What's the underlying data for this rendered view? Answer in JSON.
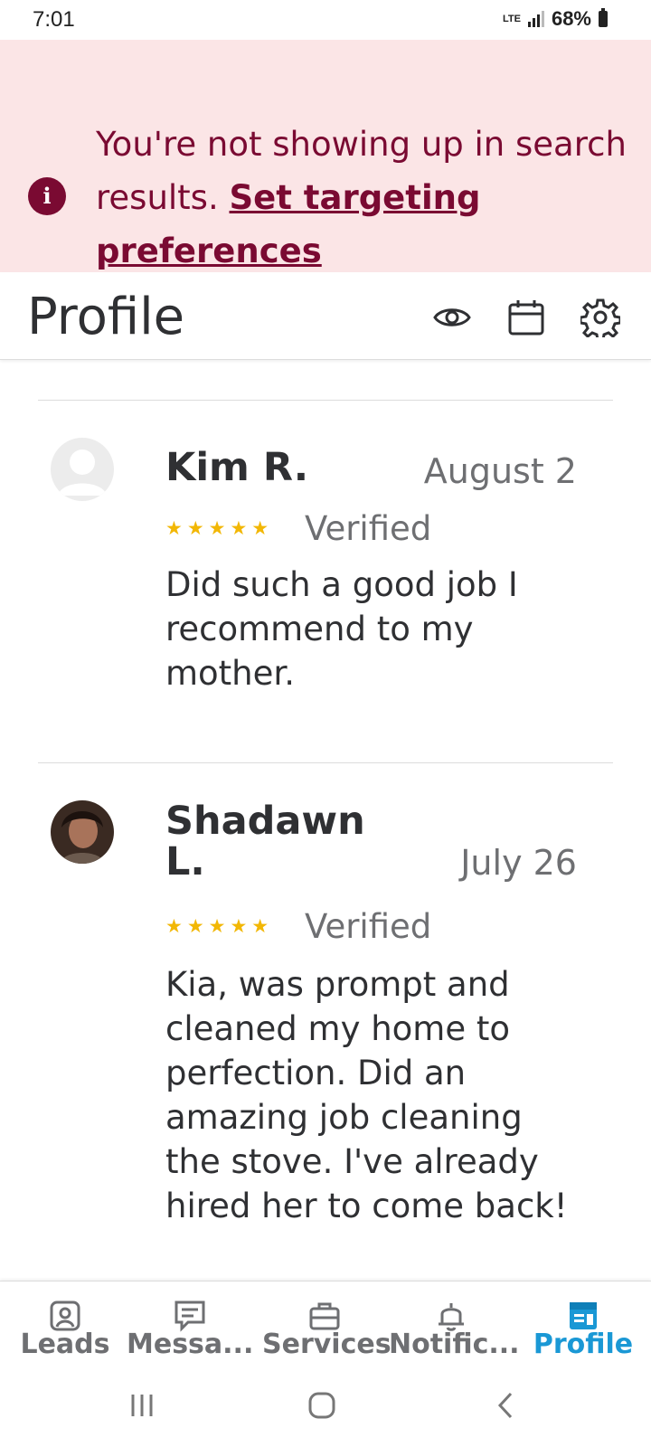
{
  "status_bar": {
    "time": "7:01",
    "network": "LTE",
    "battery": "68%"
  },
  "banner": {
    "text": "You're not showing up in search results.",
    "link": "Set targeting preferences"
  },
  "header": {
    "title": "Profile"
  },
  "reviews": [
    {
      "name": "Kim R.",
      "date": "August 2",
      "stars": "★★★★★",
      "verified": "Verified",
      "text": "Did such a good job I recommend to my mother."
    },
    {
      "name": "Shadawn L.",
      "date": "July 26",
      "stars": "★★★★★",
      "verified": "Verified",
      "text": "Kia, was prompt and cleaned my home to perfection. Did an amazing job cleaning the stove. I've already hired her to come back!"
    }
  ],
  "nav": {
    "items": [
      {
        "label": "Leads"
      },
      {
        "label": "Messa..."
      },
      {
        "label": "Services"
      },
      {
        "label": "Notific..."
      },
      {
        "label": "Profile"
      }
    ],
    "active_color": "#1a98d5"
  },
  "colors": {
    "banner_bg": "#fbe5e6",
    "banner_text": "#7a0a32",
    "star": "#f2b705"
  }
}
